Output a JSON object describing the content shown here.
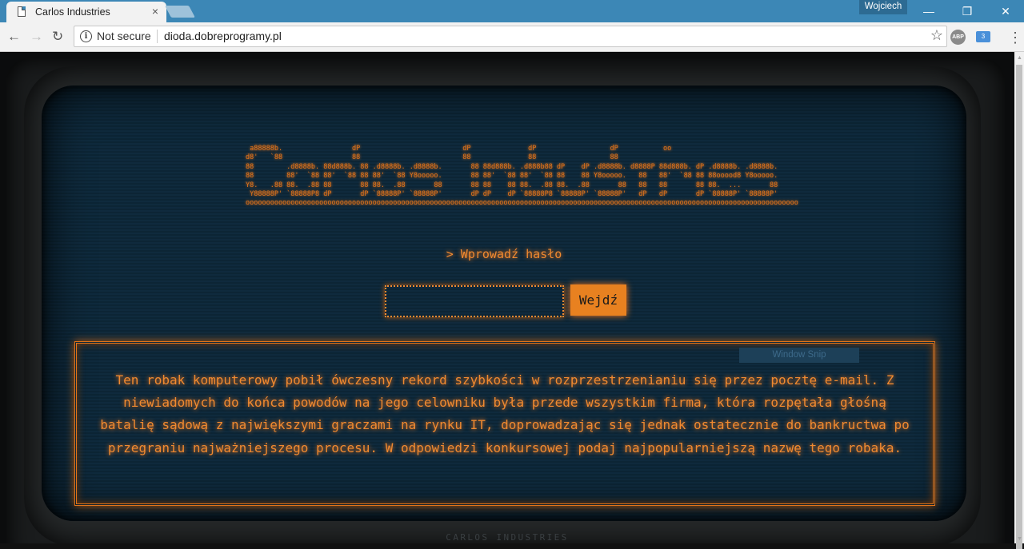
{
  "browser": {
    "tab_title": "Carlos Industries",
    "tab_close": "×",
    "user": "Wojciech",
    "security_label": "Not secure",
    "url": "dioda.dobreprogramy.pl",
    "ext_abp": "ABP",
    "ext_badge": "3"
  },
  "ascii_art": [
    " a88888b.                 dP                         dP              dP                  dP           oo",
    "d8'   `88                 88                         88              88                  88",
    "88        .d8888b. 88d888b. 88 .d8888b. .d8888b.       88 88d888b. .d888b88 dP    dP .d8888b. d8888P 88d888b. dP .d8888b. .d8888b.",
    "88        88'  `88 88'  `88 88 88'  `88 Y8ooooo.       88 88'  `88 88'  `88 88    88 Y8ooooo.   88   88'  `88 88 88ooood8 Y8ooooo.",
    "Y8.   .88 88.  .88 88       88 88.  .88       88       88 88    88 88.  .88 88.  .88       88   88   88       88 88.  ...       88",
    " Y88888P' `88888P8 dP       dP `88888P' `88888P'       dP dP    dP `88888P8 `88888P' `88888P'   dP   dP       dP `88888P' `88888P'",
    "ooooooooooooooooooooooooooooooooooooooooooooooooooooooooooooooooooooooooooooooooooooooooooooooooooooooooooooooooooooooooooooooooooooooo"
  ],
  "prompt": "> Wprowadź hasło",
  "password": {
    "value": ""
  },
  "enter_button": "Wejdź",
  "riddle": "Ten robak komputerowy pobił ówczesny rekord szybkości w rozprzestrzenianiu się przez pocztę e-mail. Z niewiadomych do końca powodów na jego celowniku była przede wszystkim firma, która rozpętała głośną batalię sądową z największymi graczami na rynku IT, doprowadzając się jednak ostatecznie do bankructwa po przegraniu najważniejszego procesu. W odpowiedzi konkursowej podaj najpopularniejszą nazwę tego robaka.",
  "overlay_label": "Window Snip",
  "footer": "CARLOS INDUSTRIES",
  "colors": {
    "accent": "#e88120",
    "text": "#f08a30",
    "screen_bg": "#0f2a3d",
    "chrome": "#3c87b6"
  },
  "icons": {
    "tab": "page-icon",
    "back": "back-arrow-icon",
    "forward": "forward-arrow-icon",
    "reload": "reload-icon",
    "info": "info-icon",
    "bookmark": "star-icon",
    "menu": "kebab-menu-icon"
  }
}
